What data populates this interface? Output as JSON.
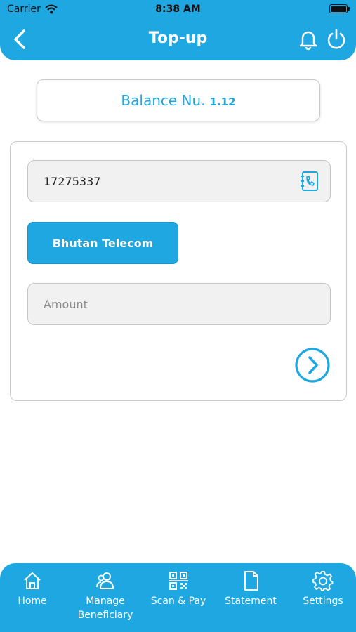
{
  "status_bar": {
    "carrier": "Carrier",
    "time": "8:38 AM"
  },
  "header": {
    "title": "Top-up"
  },
  "balance": {
    "label": "Balance Nu.",
    "value": "1.12"
  },
  "form": {
    "phone_value": "17275337",
    "operator_label": "Bhutan Telecom",
    "amount_placeholder": "Amount"
  },
  "tabbar": {
    "home": "Home",
    "manage_line1": "Manage",
    "manage_line2": "Beneficiary",
    "scan": "Scan & Pay",
    "statement": "Statement",
    "settings": "Settings"
  },
  "colors": {
    "accent": "#1ea7e1",
    "field_bg": "#f1f1f1"
  }
}
